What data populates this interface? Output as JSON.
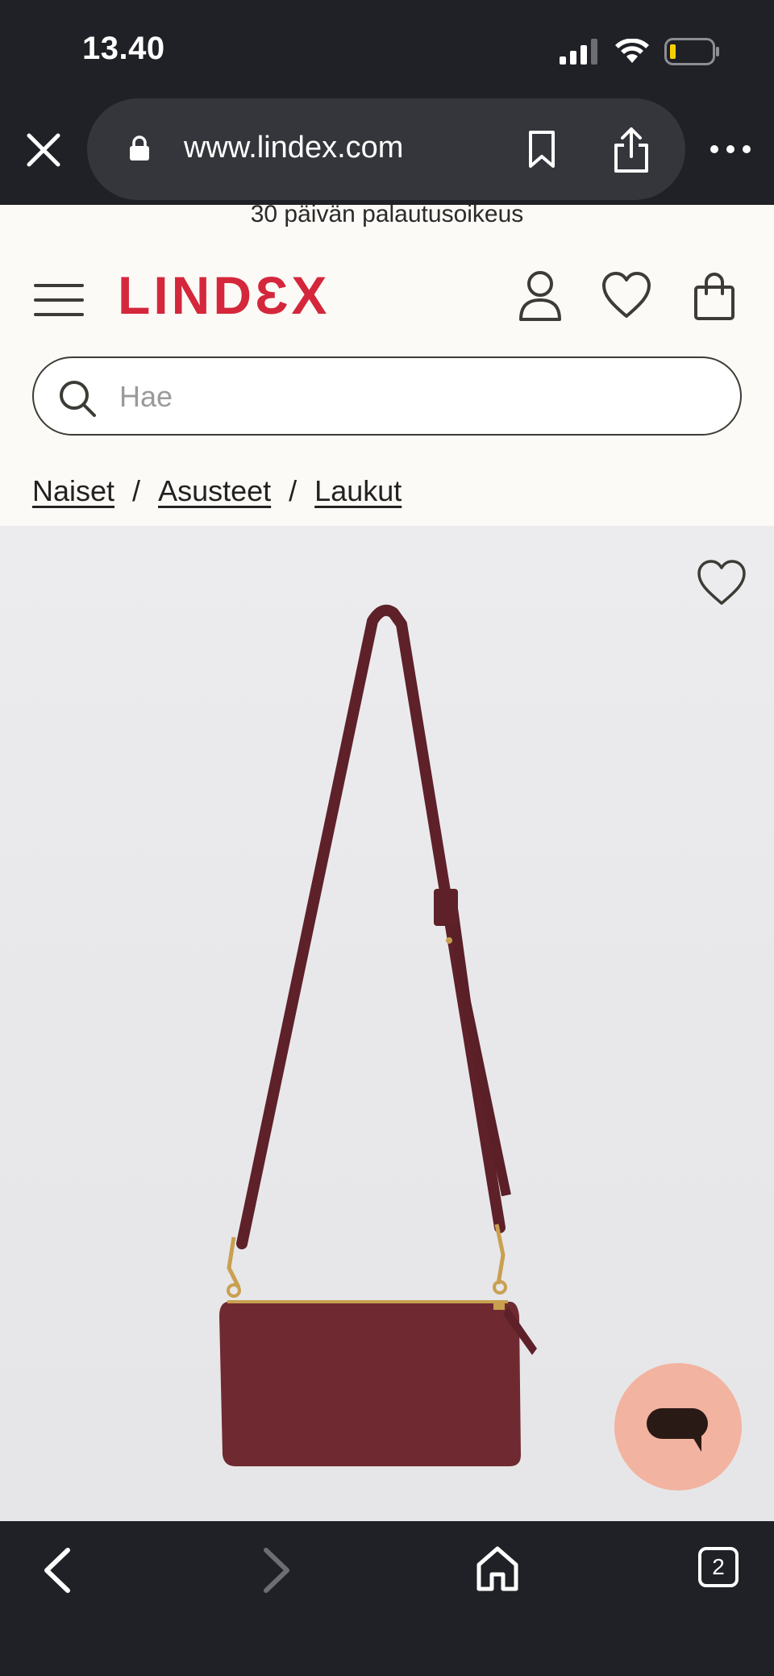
{
  "status_bar": {
    "time": "13.40",
    "icons": [
      "cellular-signal-icon",
      "wifi-icon",
      "battery-low-icon"
    ]
  },
  "browser": {
    "url": "www.lindex.com",
    "icons": [
      "close-icon",
      "lock-icon",
      "bookmark-icon",
      "share-icon",
      "more-icon"
    ]
  },
  "site": {
    "promo_text": "30 päivän palautusoikeus",
    "logo_text": "LINDƐX",
    "brand_color": "#d4273b",
    "header_icons": [
      "menu-icon",
      "account-icon",
      "heart-icon",
      "shopping-bag-icon"
    ],
    "search": {
      "placeholder": "Hae",
      "value": ""
    },
    "breadcrumb": [
      {
        "label": "Naiset"
      },
      {
        "label": "Asusteet"
      },
      {
        "label": "Laukut"
      }
    ],
    "breadcrumb_separator": "/"
  },
  "product": {
    "image_description_icon": "crossbody-bag-image",
    "bag_color": "#6f2a31"
  },
  "chat": {
    "icon": "chat-bubble-icon",
    "color": "#f2b3a0"
  },
  "toolbar": {
    "tab_count": "2",
    "icons": [
      "back-icon",
      "forward-icon",
      "home-icon",
      "tabs-icon"
    ]
  }
}
